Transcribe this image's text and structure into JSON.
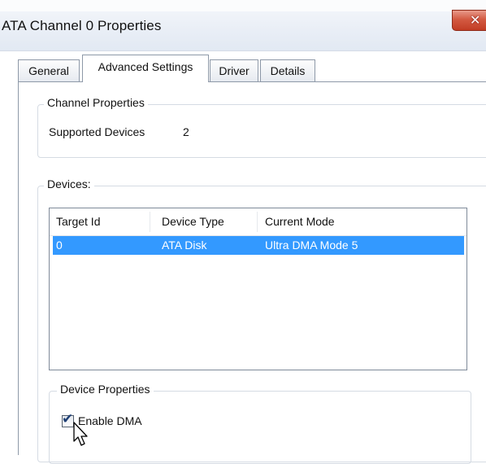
{
  "window": {
    "title": "ATA Channel 0 Properties",
    "close_glyph": "✕"
  },
  "tabs": [
    {
      "label": "General",
      "active": false
    },
    {
      "label": "Advanced Settings",
      "active": true
    },
    {
      "label": "Driver",
      "active": false
    },
    {
      "label": "Details",
      "active": false
    }
  ],
  "channel_properties": {
    "title": "Channel Properties",
    "supported_devices_label": "Supported Devices",
    "supported_devices_value": "2"
  },
  "devices": {
    "title": "Devices:",
    "columns": [
      "Target Id",
      "Device Type",
      "Current Mode"
    ],
    "rows": [
      {
        "target_id": "0",
        "device_type": "ATA Disk",
        "current_mode": "Ultra DMA Mode 5",
        "selected": true
      }
    ]
  },
  "device_properties": {
    "title": "Device Properties",
    "enable_dma_label": "Enable DMA",
    "enable_dma_checked": true,
    "check_glyph": "✔"
  },
  "colors": {
    "selection": "#3399ff",
    "close_button": "#c23d25"
  },
  "icons": {
    "close": "close-icon",
    "check": "checkmark-icon",
    "cursor": "mouse-pointer-icon"
  }
}
